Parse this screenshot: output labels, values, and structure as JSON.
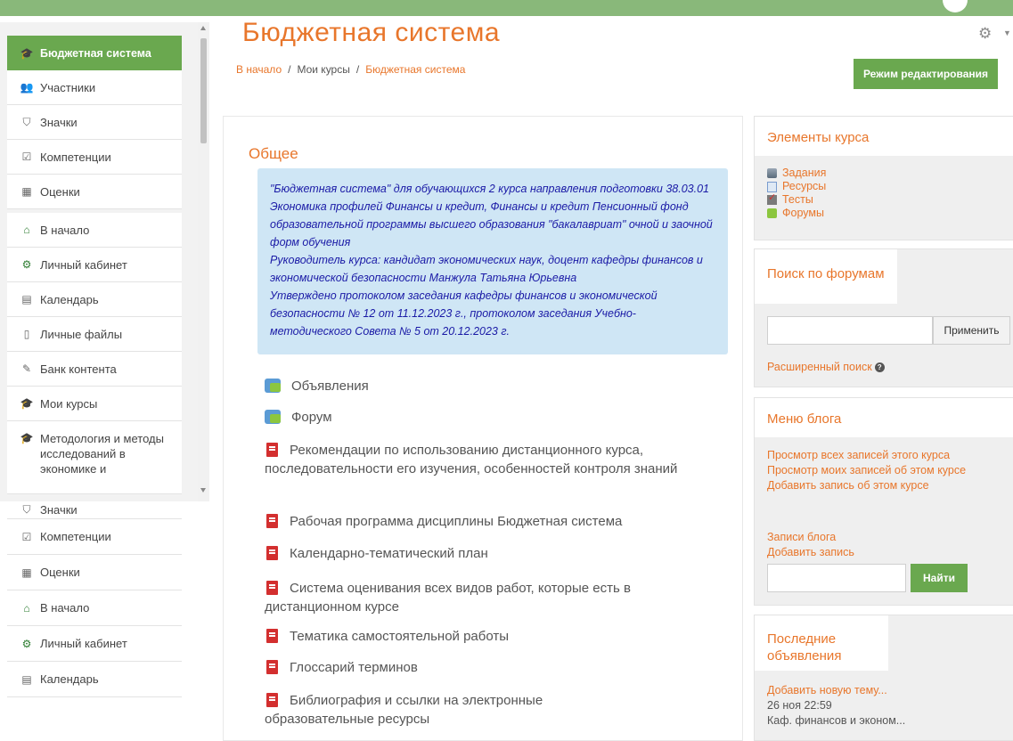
{
  "header": {
    "title": "Бюджетная система",
    "breadcrumb": {
      "home": "В начало",
      "my_courses": "Мои курсы",
      "current": "Бюджетная система",
      "separator": "/"
    },
    "edit_button": "Режим редактирования",
    "gear_icon": "gear-icon"
  },
  "nav": {
    "items": [
      {
        "label": "Бюджетная система",
        "icon": "graduation-cap-icon",
        "glyph": "🎓"
      },
      {
        "label": "Участники",
        "icon": "users-icon",
        "glyph": "👥"
      },
      {
        "label": "Значки",
        "icon": "shield-icon",
        "glyph": "⛉"
      },
      {
        "label": "Компетенции",
        "icon": "checkbox-icon",
        "glyph": "☑"
      },
      {
        "label": "Оценки",
        "icon": "table-icon",
        "glyph": "▦"
      },
      {
        "label": "В начало",
        "icon": "home-icon",
        "glyph": "⌂"
      },
      {
        "label": "Личный кабинет",
        "icon": "dashboard-icon",
        "glyph": "⚙"
      },
      {
        "label": "Календарь",
        "icon": "calendar-icon",
        "glyph": "▤"
      },
      {
        "label": "Личные файлы",
        "icon": "file-icon",
        "glyph": "▯"
      },
      {
        "label": "Банк контента",
        "icon": "brush-icon",
        "glyph": "✎"
      },
      {
        "label": "Мои курсы",
        "icon": "graduation-cap-icon",
        "glyph": "🎓"
      },
      {
        "label": "Методология и методы исследований в экономике и",
        "icon": "graduation-cap-icon",
        "glyph": "🎓"
      }
    ],
    "bottom_items": [
      {
        "label": "Значки",
        "icon": "shield-icon",
        "glyph": "⛉"
      },
      {
        "label": "Компетенции",
        "icon": "checkbox-icon",
        "glyph": "☑"
      },
      {
        "label": "Оценки",
        "icon": "table-icon",
        "glyph": "▦"
      },
      {
        "label": "В начало",
        "icon": "home-icon",
        "glyph": "⌂"
      },
      {
        "label": "Личный кабинет",
        "icon": "dashboard-icon",
        "glyph": "⚙"
      },
      {
        "label": "Календарь",
        "icon": "calendar-icon",
        "glyph": "▤"
      }
    ]
  },
  "section": {
    "title": "Общее",
    "info": [
      "\"Бюджетная система\" для обучающихся 2 курса направления подготовки 38.03.01 Экономика профилей Финансы и кредит, Финансы и кредит Пенсионный фонд образовательной программы высшего образования \"бакалавриат\" очной и заочной форм обучения",
      "Руководитель курса: кандидат экономических наук, доцент кафедры финансов и экономической безопасности Манжула Татьяна Юрьевна",
      "Утверждено протоколом заседания кафедры финансов и экономической безопасности № 12 от 11.12.2023 г., протоколом заседания Учебно-методического Совета № 5 от 20.12.2023 г."
    ],
    "activities": [
      {
        "label": "Объявления",
        "type": "forum"
      },
      {
        "label": "Форум",
        "type": "forum"
      },
      {
        "label": "Рекомендации по использованию дистанционного курса, последовательности его изучения, особенностей контроля знаний",
        "type": "pdf"
      },
      {
        "label": "Рабочая программа дисциплины Бюджетная система",
        "type": "pdf"
      },
      {
        "label": "Календарно-тематический план",
        "type": "pdf"
      },
      {
        "label": "Система оценивания всех видов работ, которые есть в дистанционном курсе",
        "type": "pdf"
      },
      {
        "label": "Тематика самостоятельной работы",
        "type": "pdf"
      },
      {
        "label": "Глоссарий терминов",
        "type": "pdf"
      },
      {
        "label": "Библиография и ссылки на электронные образовательные ресурсы",
        "type": "pdf"
      }
    ]
  },
  "blocks": {
    "elements": {
      "title": "Элементы курса",
      "items": [
        "Задания",
        "Ресурсы",
        "Тесты",
        "Форумы"
      ]
    },
    "forum_search": {
      "title": "Поиск по форумам",
      "input_value": "",
      "apply": "Применить",
      "advanced": "Расширенный поиск"
    },
    "blog": {
      "title": "Меню блога",
      "links": [
        "Просмотр всех записей этого курса",
        "Просмотр моих записей об этом курсе",
        "Добавить запись об этом курсе"
      ],
      "links2": [
        "Записи блога",
        "Добавить запись"
      ],
      "input_value": "",
      "find": "Найти"
    },
    "news": {
      "title": "Последние объявления",
      "add": "Добавить новую тему...",
      "date": "26 ноя 22:59",
      "author": "Каф. финансов и эконом..."
    }
  },
  "colors": {
    "accent_orange": "#e8762b",
    "green": "#6aa84f",
    "info_bg": "#cfe6f5",
    "info_text": "#1a1aa6"
  }
}
